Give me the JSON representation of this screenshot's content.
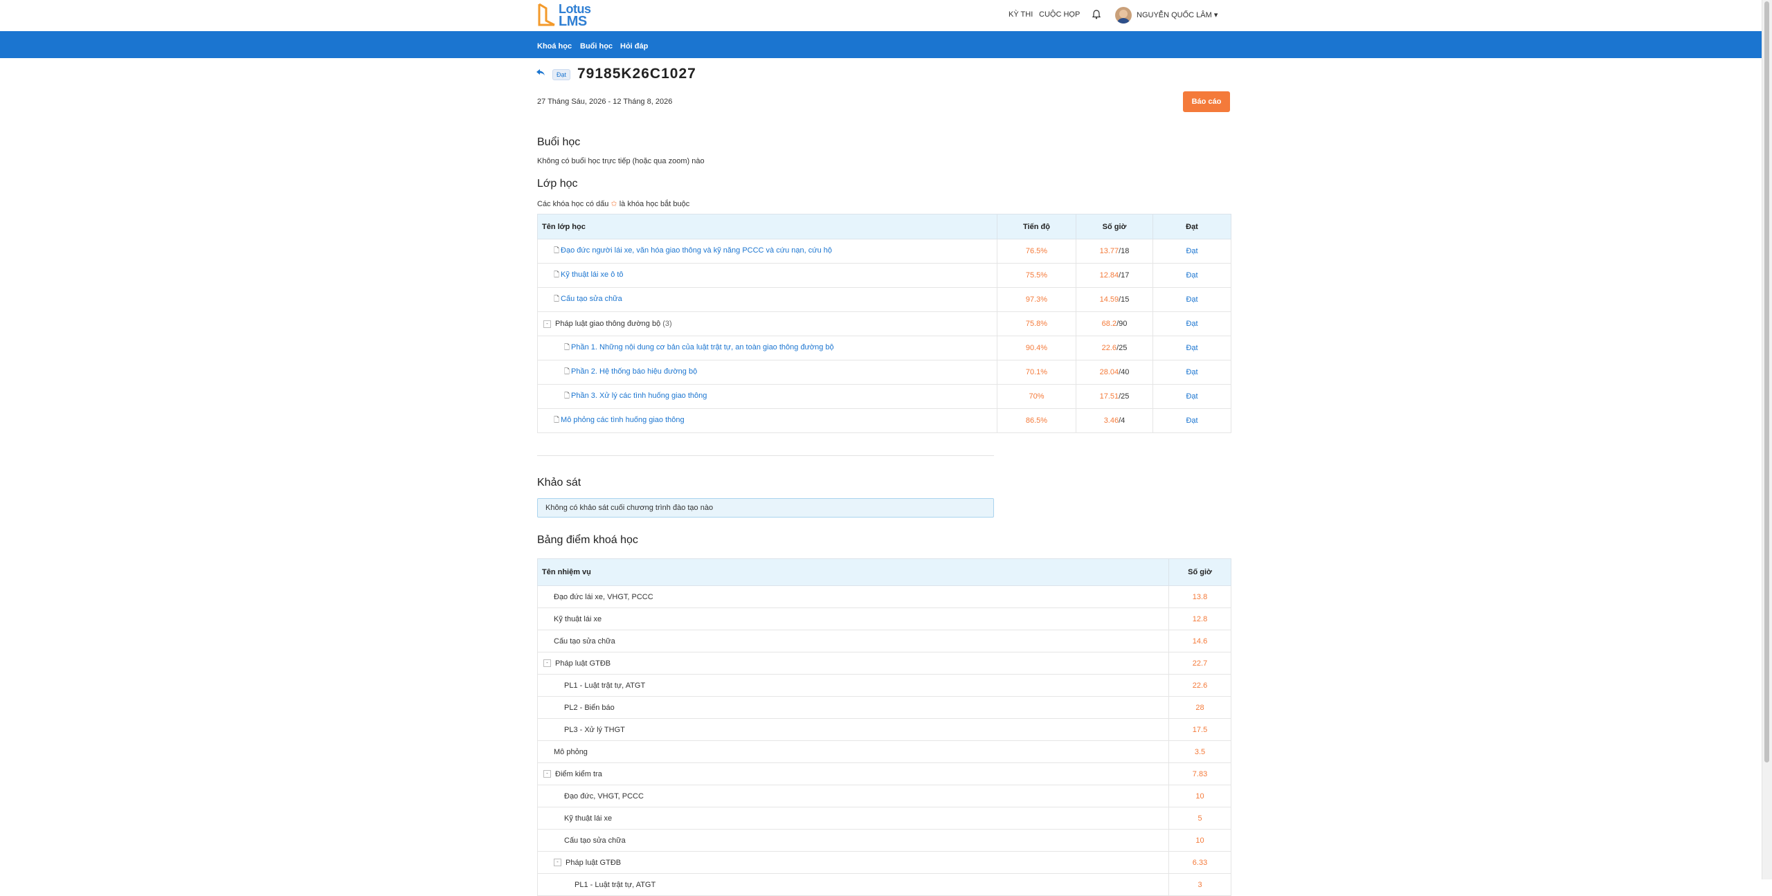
{
  "header": {
    "logo_top": "Lotus",
    "logo_bottom": "LMS",
    "links": [
      "KỲ THI",
      "CUỘC HỌP"
    ],
    "user_name": "NGUYỄN QUỐC LÂM",
    "user_caret": "▾"
  },
  "nav": {
    "items": [
      "Khoá học",
      "Buổi học",
      "Hỏi đáp"
    ]
  },
  "course": {
    "status_badge": "Đạt",
    "code": "79185K26C1027",
    "date_range": "27 Tháng Sáu, 2026 - 12 Tháng 8, 2026",
    "report_button": "Báo cáo"
  },
  "sessions": {
    "heading": "Buổi học",
    "empty_note": "Không có buổi học trực tiếp (hoặc qua zoom) nào"
  },
  "classes": {
    "heading": "Lớp học",
    "required_note_before": "Các khóa học có dấu",
    "required_star": "✩",
    "required_note_after": "là khóa học bắt buộc",
    "columns": [
      "Tên lớp học",
      "Tiến độ",
      "Số giờ",
      "Đạt"
    ],
    "rows": [
      {
        "name": "Đạo đức người lái xe, văn hóa giao thông và kỹ năng PCCC và cứu nạn, cứu hộ",
        "progress": "76.5%",
        "hours_done": "13.77",
        "hours_total": "/18",
        "status": "Đạt",
        "level": 1,
        "type": "doc"
      },
      {
        "name": "Kỹ thuật lái xe ô tô",
        "progress": "75.5%",
        "hours_done": "12.84",
        "hours_total": "/17",
        "status": "Đạt",
        "level": 1,
        "type": "doc"
      },
      {
        "name": "Cấu tạo sửa chữa",
        "progress": "97.3%",
        "hours_done": "14.59",
        "hours_total": "/15",
        "status": "Đạt",
        "level": 1,
        "type": "doc"
      },
      {
        "name": "Pháp luật giao thông đường bộ",
        "count": "(3)",
        "progress": "75.8%",
        "hours_done": "68.2",
        "hours_total": "/90",
        "status": "Đạt",
        "level": 0,
        "type": "group"
      },
      {
        "name": "Phần 1. Những nội dung cơ bản của luật trật tự, an toàn giao thông đường bộ",
        "progress": "90.4%",
        "hours_done": "22.6",
        "hours_total": "/25",
        "status": "Đạt",
        "level": 2,
        "type": "doc"
      },
      {
        "name": "Phần 2. Hệ thống báo hiệu đường bộ",
        "progress": "70.1%",
        "hours_done": "28.04",
        "hours_total": "/40",
        "status": "Đạt",
        "level": 2,
        "type": "doc"
      },
      {
        "name": "Phần 3. Xử lý các tình huống giao thông",
        "progress": "70%",
        "hours_done": "17.51",
        "hours_total": "/25",
        "status": "Đạt",
        "level": 2,
        "type": "doc"
      },
      {
        "name": "Mô phỏng các tình huống giao thông",
        "progress": "86.5%",
        "hours_done": "3.46",
        "hours_total": "/4",
        "status": "Đạt",
        "level": 1,
        "type": "doc"
      }
    ]
  },
  "survey": {
    "heading": "Khảo sát",
    "empty_note": "Không có khảo sát cuối chương trình đào tạo nào"
  },
  "scores": {
    "heading": "Bảng điểm khoá học",
    "columns": [
      "Tên nhiệm vụ",
      "Số giờ"
    ],
    "rows": [
      {
        "name": "Đạo đức lái xe, VHGT, PCCC",
        "value": "13.8",
        "level": 1,
        "toggle": false
      },
      {
        "name": "Kỹ thuật lái xe",
        "value": "12.8",
        "level": 1,
        "toggle": false
      },
      {
        "name": "Cấu tạo sửa chữa",
        "value": "14.6",
        "level": 1,
        "toggle": false
      },
      {
        "name": "Pháp luật GTĐB",
        "value": "22.7",
        "level": 0,
        "toggle": true
      },
      {
        "name": "PL1 - Luật trật tự, ATGT",
        "value": "22.6",
        "level": 2,
        "toggle": false
      },
      {
        "name": "PL2 - Biển báo",
        "value": "28",
        "level": 2,
        "toggle": false
      },
      {
        "name": "PL3 - Xử lý THGT",
        "value": "17.5",
        "level": 2,
        "toggle": false
      },
      {
        "name": "Mô phỏng",
        "value": "3.5",
        "level": 1,
        "toggle": false
      },
      {
        "name": "Điểm kiểm tra",
        "value": "7.83",
        "level": 0,
        "toggle": true
      },
      {
        "name": "Đạo đức, VHGT, PCCC",
        "value": "10",
        "level": 2,
        "toggle": false
      },
      {
        "name": "Kỹ thuật lái xe",
        "value": "5",
        "level": 2,
        "toggle": false
      },
      {
        "name": "Cấu tạo sửa chữa",
        "value": "10",
        "level": 2,
        "toggle": false
      },
      {
        "name": "Pháp luật GTĐB",
        "value": "6.33",
        "level": 3,
        "toggle": true
      },
      {
        "name": "PL1 - Luật trật tự, ATGT",
        "value": "3",
        "level": 4,
        "toggle": false
      }
    ]
  },
  "colors": {
    "primary": "#1b75d0",
    "accent": "#f47a3a",
    "header_bg": "#e6f4fc"
  }
}
